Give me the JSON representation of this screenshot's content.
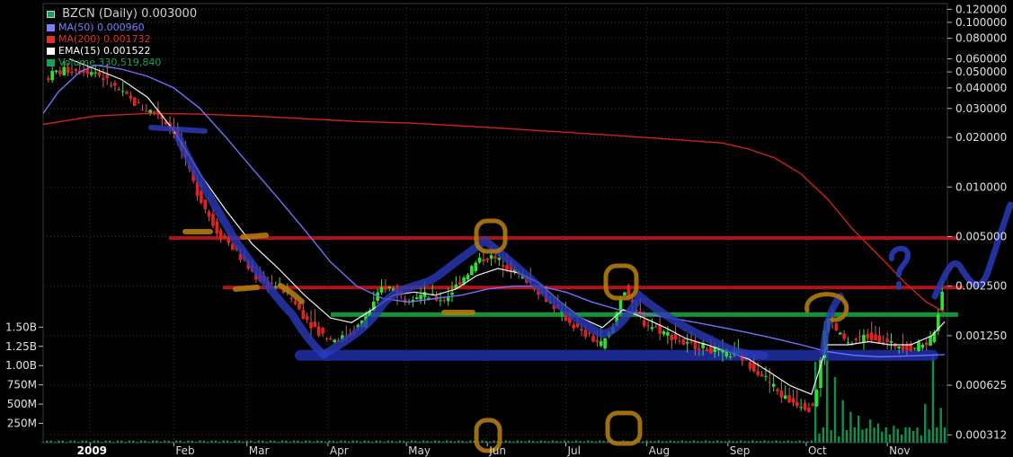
{
  "chart_data": {
    "type": "line",
    "title": "BZCN (Daily) 0.003000",
    "legend": [
      {
        "label": "MA(50) 0.000960",
        "color": "#7d7dff"
      },
      {
        "label": "MA(200) 0.001732",
        "color": "#e03030"
      },
      {
        "label": "EMA(15) 0.001522",
        "color": "#ffffff"
      },
      {
        "label": "Volume 330,519,840",
        "color": "#13a35c"
      }
    ],
    "yaxis_right": {
      "scale": "log",
      "ylim": [
        0.00028,
        0.13
      ],
      "ticks": [
        {
          "value": 0.12,
          "label": "0.120000"
        },
        {
          "value": 0.1,
          "label": "0.100000"
        },
        {
          "value": 0.08,
          "label": "0.080000"
        },
        {
          "value": 0.06,
          "label": "0.060000"
        },
        {
          "value": 0.05,
          "label": "0.050000"
        },
        {
          "value": 0.04,
          "label": "0.040000"
        },
        {
          "value": 0.03,
          "label": "0.030000"
        },
        {
          "value": 0.02,
          "label": "0.020000"
        },
        {
          "value": 0.01,
          "label": "0.010000"
        },
        {
          "value": 0.005,
          "label": "0.005000"
        },
        {
          "value": 0.0025,
          "label": "0.002500"
        },
        {
          "value": 0.00125,
          "label": "0.001250"
        },
        {
          "value": 0.000625,
          "label": "0.000625"
        },
        {
          "value": 0.000312,
          "label": "0.000312"
        }
      ]
    },
    "yaxis_left_volume": {
      "ylim": [
        0,
        1.9
      ],
      "unit_note": "billions",
      "ticks": [
        {
          "value": 1.5,
          "label": "1.50B"
        },
        {
          "value": 1.25,
          "label": "1.25B"
        },
        {
          "value": 1.0,
          "label": "1.00B"
        },
        {
          "value": 0.75,
          "label": "750M"
        },
        {
          "value": 0.5,
          "label": "500M"
        },
        {
          "value": 0.25,
          "label": "250M"
        }
      ]
    },
    "xaxis": {
      "day_range": [
        0,
        330
      ],
      "ticks": [
        {
          "day": 18,
          "label": "2009",
          "bold": true
        },
        {
          "day": 50,
          "label": "Feb"
        },
        {
          "day": 78,
          "label": "Mar"
        },
        {
          "day": 109,
          "label": "Apr"
        },
        {
          "day": 139,
          "label": "May"
        },
        {
          "day": 170,
          "label": "Jun"
        },
        {
          "day": 200,
          "label": "Jul"
        },
        {
          "day": 231,
          "label": "Aug"
        },
        {
          "day": 262,
          "label": "Sep"
        },
        {
          "day": 292,
          "label": "Oct"
        },
        {
          "day": 323,
          "label": "Nov"
        }
      ]
    },
    "price_path": [
      [
        0,
        0.045
      ],
      [
        5,
        0.05
      ],
      [
        12,
        0.052
      ],
      [
        20,
        0.05
      ],
      [
        26,
        0.042
      ],
      [
        32,
        0.035
      ],
      [
        38,
        0.03
      ],
      [
        44,
        0.028
      ],
      [
        50,
        0.022
      ],
      [
        54,
        0.015
      ],
      [
        58,
        0.01
      ],
      [
        62,
        0.0075
      ],
      [
        66,
        0.0055
      ],
      [
        70,
        0.0048
      ],
      [
        74,
        0.004
      ],
      [
        78,
        0.0033
      ],
      [
        82,
        0.0028
      ],
      [
        86,
        0.0026
      ],
      [
        90,
        0.0025
      ],
      [
        94,
        0.0022
      ],
      [
        98,
        0.0018
      ],
      [
        102,
        0.0015
      ],
      [
        106,
        0.0013
      ],
      [
        110,
        0.0012
      ],
      [
        114,
        0.0012
      ],
      [
        118,
        0.0013
      ],
      [
        122,
        0.0015
      ],
      [
        126,
        0.0019
      ],
      [
        130,
        0.0025
      ],
      [
        134,
        0.0024
      ],
      [
        138,
        0.0021
      ],
      [
        142,
        0.0022
      ],
      [
        146,
        0.0022
      ],
      [
        150,
        0.0021
      ],
      [
        154,
        0.0021
      ],
      [
        158,
        0.0025
      ],
      [
        162,
        0.003
      ],
      [
        166,
        0.0035
      ],
      [
        170,
        0.0038
      ],
      [
        174,
        0.0036
      ],
      [
        178,
        0.0033
      ],
      [
        182,
        0.0029
      ],
      [
        186,
        0.0027
      ],
      [
        190,
        0.0023
      ],
      [
        194,
        0.002
      ],
      [
        198,
        0.0017
      ],
      [
        202,
        0.0015
      ],
      [
        206,
        0.0013
      ],
      [
        210,
        0.0012
      ],
      [
        214,
        0.0011
      ],
      [
        218,
        0.0014
      ],
      [
        222,
        0.0025
      ],
      [
        226,
        0.0018
      ],
      [
        230,
        0.0015
      ],
      [
        234,
        0.0014
      ],
      [
        238,
        0.0013
      ],
      [
        242,
        0.0012
      ],
      [
        246,
        0.0011
      ],
      [
        250,
        0.0011
      ],
      [
        254,
        0.00105
      ],
      [
        258,
        0.001
      ],
      [
        262,
        0.00098
      ],
      [
        266,
        0.00095
      ],
      [
        270,
        0.00085
      ],
      [
        274,
        0.00075
      ],
      [
        278,
        0.00065
      ],
      [
        282,
        0.00055
      ],
      [
        286,
        0.0005
      ],
      [
        290,
        0.00048
      ],
      [
        294,
        0.00045
      ],
      [
        296,
        0.0006
      ],
      [
        300,
        0.0017
      ],
      [
        304,
        0.0013
      ],
      [
        308,
        0.0011
      ],
      [
        312,
        0.0012
      ],
      [
        316,
        0.00125
      ],
      [
        320,
        0.0012
      ],
      [
        324,
        0.0011
      ],
      [
        328,
        0.0011
      ],
      [
        332,
        0.00105
      ],
      [
        336,
        0.0011
      ],
      [
        340,
        0.0012
      ],
      [
        342,
        0.0016
      ],
      [
        344,
        0.0022
      ],
      [
        345,
        0.003
      ]
    ],
    "ma50": [
      [
        0,
        0.028
      ],
      [
        6,
        0.038
      ],
      [
        14,
        0.05
      ],
      [
        20,
        0.055
      ],
      [
        30,
        0.052
      ],
      [
        40,
        0.047
      ],
      [
        50,
        0.04
      ],
      [
        60,
        0.03
      ],
      [
        70,
        0.02
      ],
      [
        80,
        0.013
      ],
      [
        90,
        0.0085
      ],
      [
        100,
        0.0055
      ],
      [
        110,
        0.0035
      ],
      [
        120,
        0.0025
      ],
      [
        130,
        0.0021
      ],
      [
        140,
        0.002
      ],
      [
        150,
        0.0021
      ],
      [
        160,
        0.0022
      ],
      [
        170,
        0.0024
      ],
      [
        180,
        0.0025
      ],
      [
        190,
        0.0025
      ],
      [
        200,
        0.0023
      ],
      [
        210,
        0.002
      ],
      [
        220,
        0.0018
      ],
      [
        230,
        0.0017
      ],
      [
        240,
        0.0016
      ],
      [
        250,
        0.0015
      ],
      [
        260,
        0.0014
      ],
      [
        270,
        0.0013
      ],
      [
        280,
        0.0012
      ],
      [
        290,
        0.0011
      ],
      [
        300,
        0.001
      ],
      [
        310,
        0.00095
      ],
      [
        320,
        0.00093
      ],
      [
        330,
        0.00094
      ],
      [
        345,
        0.00096
      ]
    ],
    "ma200": [
      [
        0,
        0.024
      ],
      [
        20,
        0.027
      ],
      [
        40,
        0.028
      ],
      [
        60,
        0.0277
      ],
      [
        80,
        0.027
      ],
      [
        100,
        0.026
      ],
      [
        120,
        0.025
      ],
      [
        140,
        0.0245
      ],
      [
        160,
        0.0235
      ],
      [
        180,
        0.0225
      ],
      [
        200,
        0.0215
      ],
      [
        220,
        0.0205
      ],
      [
        240,
        0.0195
      ],
      [
        260,
        0.0185
      ],
      [
        270,
        0.017
      ],
      [
        280,
        0.015
      ],
      [
        290,
        0.012
      ],
      [
        300,
        0.0085
      ],
      [
        310,
        0.0055
      ],
      [
        320,
        0.0038
      ],
      [
        330,
        0.0026
      ],
      [
        338,
        0.002
      ],
      [
        345,
        0.00173
      ]
    ],
    "ema15": [
      [
        10,
        0.06
      ],
      [
        20,
        0.052
      ],
      [
        30,
        0.045
      ],
      [
        40,
        0.035
      ],
      [
        50,
        0.022
      ],
      [
        60,
        0.012
      ],
      [
        70,
        0.0072
      ],
      [
        80,
        0.0045
      ],
      [
        90,
        0.0032
      ],
      [
        100,
        0.0022
      ],
      [
        110,
        0.0016
      ],
      [
        118,
        0.0015
      ],
      [
        126,
        0.0018
      ],
      [
        134,
        0.0022
      ],
      [
        142,
        0.0023
      ],
      [
        150,
        0.0022
      ],
      [
        158,
        0.0024
      ],
      [
        166,
        0.0029
      ],
      [
        174,
        0.0032
      ],
      [
        182,
        0.003
      ],
      [
        190,
        0.0026
      ],
      [
        198,
        0.002
      ],
      [
        206,
        0.0016
      ],
      [
        214,
        0.0014
      ],
      [
        222,
        0.0018
      ],
      [
        230,
        0.0016
      ],
      [
        238,
        0.0014
      ],
      [
        246,
        0.0012
      ],
      [
        254,
        0.0011
      ],
      [
        262,
        0.001
      ],
      [
        270,
        0.0009
      ],
      [
        278,
        0.00075
      ],
      [
        286,
        0.00062
      ],
      [
        294,
        0.00055
      ],
      [
        300,
        0.0011
      ],
      [
        308,
        0.0011
      ],
      [
        316,
        0.00115
      ],
      [
        324,
        0.0011
      ],
      [
        332,
        0.0011
      ],
      [
        340,
        0.00125
      ],
      [
        345,
        0.00152
      ]
    ],
    "volume_spikes": [
      [
        296,
        1.05
      ],
      [
        300,
        1.6
      ],
      [
        303,
        0.85
      ],
      [
        306,
        0.55
      ],
      [
        309,
        0.4
      ],
      [
        312,
        0.35
      ],
      [
        316,
        0.3
      ],
      [
        320,
        0.25
      ],
      [
        326,
        0.22
      ],
      [
        332,
        0.2
      ],
      [
        338,
        0.5
      ],
      [
        341,
        1.15
      ],
      [
        343,
        0.45
      ],
      [
        345,
        0.2
      ]
    ],
    "resistance_levels": [
      {
        "value": 0.0049,
        "color": "#c01818"
      },
      {
        "value": 0.00245,
        "color": "#c01818"
      },
      {
        "value": 0.00168,
        "color": "#13a33c"
      }
    ],
    "support_level": {
      "value": 0.00095,
      "color": "#2030a8"
    }
  }
}
